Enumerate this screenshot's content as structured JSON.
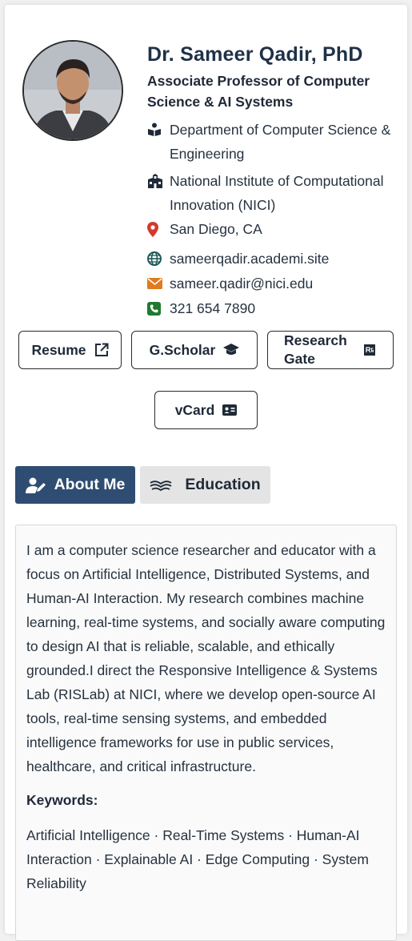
{
  "profile": {
    "name": "Dr. Sameer Qadir, PhD",
    "title": "Associate Professor of Computer Science & AI Systems"
  },
  "info": {
    "department": "Department of Computer Science & Engineering",
    "institute": "National Institute of Computational Innovation (NICI)",
    "location": "San Diego, CA",
    "website": "sameerqadir.academi.site",
    "email": "sameer.qadir@nici.edu",
    "phone": "321 654 7890"
  },
  "buttons": {
    "resume": "Resume",
    "scholar": "G.Scholar",
    "research_gate": "Research Gate",
    "vcard": "vCard"
  },
  "tabs": {
    "about": "About Me",
    "education": "Education"
  },
  "about": {
    "text": "I am a computer science researcher and educator with a focus on Artificial Intelligence, Distributed Systems, and Human-AI Interaction. My research combines machine learning, real-time systems, and socially aware computing to design AI that is reliable, scalable, and ethically grounded.I direct the Responsive Intelligence & Systems Lab (RISLab) at NICI, where we develop open-source AI tools, real-time sensing systems, and embedded intelligence frameworks for use in public services, healthcare, and critical infrastructure.",
    "keywords_label": "Keywords:",
    "keywords": "Artificial Intelligence · Real-Time Systems · Human-AI Interaction · Explainable AI · Edge Computing · System Reliability"
  },
  "colors": {
    "accent": "#2f4d72",
    "location_pin": "#d23b2b",
    "email_icon": "#e07b1f",
    "phone_icon": "#1f7a2e",
    "web_icon": "#1d5a56"
  }
}
